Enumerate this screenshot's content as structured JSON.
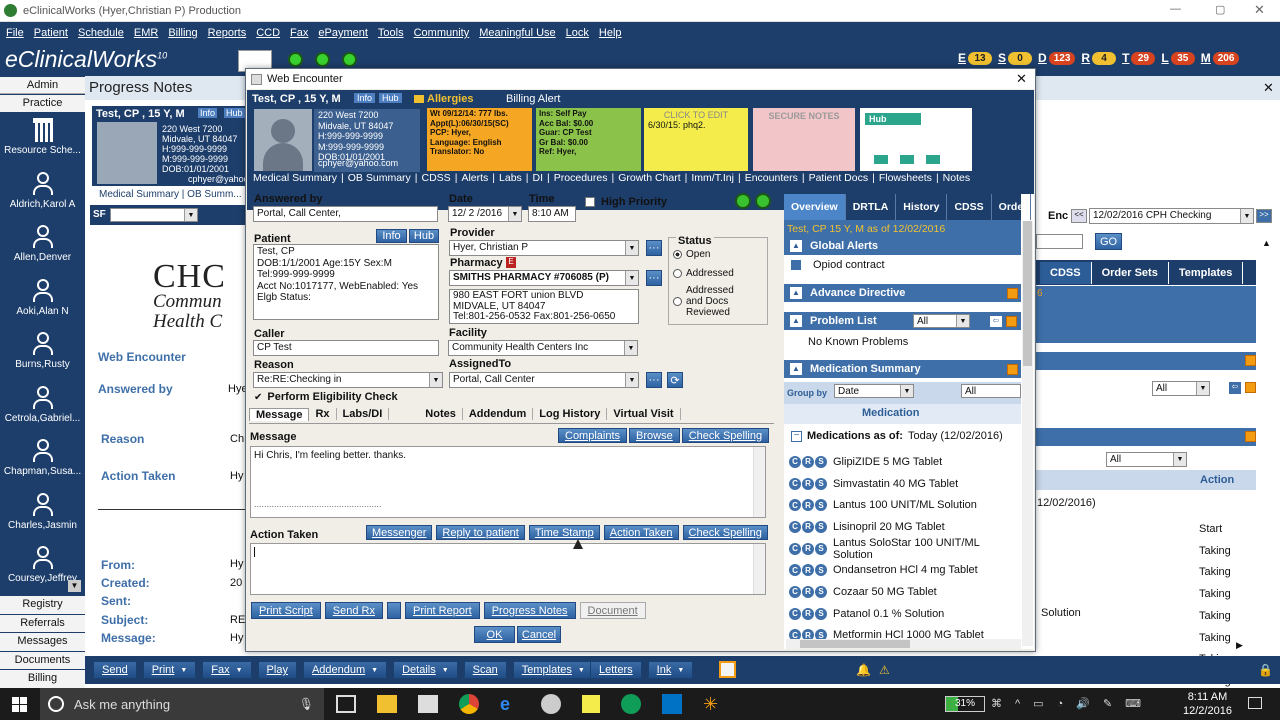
{
  "window": {
    "title": "eClinicalWorks (Hyer,Christian P)  Production"
  },
  "menu": [
    "File",
    "Patient",
    "Schedule",
    "EMR",
    "Billing",
    "Reports",
    "CCD",
    "Fax",
    "ePayment",
    "Tools",
    "Community",
    "Meaningful Use",
    "Lock",
    "Help"
  ],
  "brand": {
    "name": "eClinicalWorks",
    "version": "10"
  },
  "counters": [
    {
      "letter": "E",
      "value": "13",
      "color": "#f0c030"
    },
    {
      "letter": "S",
      "value": "0",
      "color": "#f0c030"
    },
    {
      "letter": "D",
      "value": "123",
      "color": "#d8431f"
    },
    {
      "letter": "R",
      "value": "4",
      "color": "#f0c030"
    },
    {
      "letter": "T",
      "value": "29",
      "color": "#d8431f"
    },
    {
      "letter": "L",
      "value": "35",
      "color": "#d8431f"
    },
    {
      "letter": "M",
      "value": "206",
      "color": "#d8431f"
    }
  ],
  "sidebar": {
    "top_items": [
      "Admin",
      "Practice"
    ],
    "users": [
      "Resource Sche...",
      "Aldrich,Karol A",
      "Allen,Denver",
      "Aoki,Alan N",
      "Burns,Rusty",
      "Cetrola,Gabriel...",
      "Chapman,Susa...",
      "Charles,Jasmin",
      "Coursey,Jeffrey"
    ],
    "bottom_items": [
      "Registry",
      "Referrals",
      "Messages",
      "Documents",
      "Billing"
    ]
  },
  "progress_notes": {
    "title": "Progress Notes",
    "patient": "Test, CP , 15 Y, M",
    "info": "Info",
    "hub": "Hub",
    "address": [
      "220 West 7200",
      "Midvale, UT 84047",
      "H:999-999-9999",
      "M:999-999-9999",
      "DOB:01/01/2001"
    ],
    "email": "cphyer@yahoo.c...",
    "tabs": "Medical Summary | OB Summ...",
    "sf": "SF",
    "logo_text": [
      "CHC",
      "Commun",
      "Health C"
    ],
    "web_encounter": "Web Encounter",
    "answered_by": "Answered by",
    "answered_val": "Hye",
    "reason": "Reason",
    "reason_val": "Ch",
    "action_taken": "Action Taken",
    "action_val": "Hy",
    "from": "From:",
    "from_val": "Hy",
    "created": "Created:",
    "created_val": "20",
    "sent": "Sent:",
    "subject": "Subject:",
    "subject_val": "RE",
    "message": "Message:",
    "message_val": "Hy"
  },
  "right_panel": {
    "enc": "Enc",
    "enc_val": "12/02/2016 CPH Checking",
    "go": "GO",
    "tabs": [
      "CDSS",
      "Order Sets",
      "Templates"
    ],
    "all1": "All",
    "all2": "All",
    "date_partial": "12/02/2016)",
    "action_hdr": "Action",
    "actions": [
      "Start",
      "Taking",
      "Taking",
      "Taking",
      "Taking",
      "Taking",
      "Taking",
      "Taking"
    ],
    "solution": "Solution",
    "six": "6"
  },
  "dialog": {
    "title": "Web Encounter",
    "patient": "Test, CP , 15 Y, M",
    "info": "Info",
    "hub": "Hub",
    "allergies": "Allergies",
    "billing_alert": "Billing Alert",
    "address": [
      "220 West 7200",
      "Midvale, UT 84047",
      "H:999-999-9999",
      "M:999-999-9999",
      "DOB:01/01/2001"
    ],
    "email": "cphyer@yahoo.com",
    "vitals": [
      "Wt 09/12/14: 777 lbs.",
      "Appt(L):06/30/15(SC)",
      "PCP:   Hyer,",
      "Language: English",
      "Translator: No"
    ],
    "insurance": [
      "Ins:   Self Pay",
      "Acc Bal: $0.00",
      "Guar:  CP Test",
      "Gr Bal: $0.00",
      "Ref:   Hyer,"
    ],
    "sticky": {
      "title": "CLICK TO EDIT",
      "text": "6/30/15: phq2."
    },
    "secure": "SECURE NOTES",
    "hub_box": "Hub",
    "nav": [
      "Medical Summary",
      "OB Summary",
      "CDSS",
      "Alerts",
      "Labs",
      "DI",
      "Procedures",
      "Growth Chart",
      "Imm/T.Inj",
      "Encounters",
      "Patient Docs",
      "Flowsheets",
      "Notes"
    ],
    "form": {
      "answered_by_label": "Answered by",
      "answered_by": "Portal, Call Center,",
      "date_label": "Date",
      "date": "12/ 2 /2016",
      "time_label": "Time",
      "time": "8:10 AM",
      "high_priority": "High Priority",
      "patient_label": "Patient",
      "info": "Info",
      "hub": "Hub",
      "patient_lines": [
        "Test, CP",
        "DOB:1/1/2001  Age:15Y  Sex:M",
        "Tel:999-999-9999",
        "Acct No:1017177, WebEnabled: Yes",
        "Elgb Status:"
      ],
      "provider_label": "Provider",
      "provider": "Hyer, Christian P",
      "pharmacy_label": "Pharmacy",
      "pharmacy": "SMITHS PHARMACY #706085 (P)",
      "pharmacy_addr": [
        "980 EAST FORT union BLVD",
        "MIDVALE, UT 84047",
        "Tel:801-256-0532 Fax:801-256-0650"
      ],
      "status_label": "Status",
      "status_opts": [
        "Open",
        "Addressed",
        "Addressed and Docs Reviewed"
      ],
      "caller_label": "Caller",
      "caller": "CP Test",
      "facility_label": "Facility",
      "facility": "Community Health Centers Inc",
      "reason_label": "Reason",
      "reason": "Re:RE:Checking in",
      "assigned_label": "AssignedTo",
      "assigned": "Portal, Call Center",
      "eligibility": "Perform Eligibility Check"
    },
    "msg_tabs": [
      "Message",
      "Rx",
      "Labs/DI",
      "Notes",
      "Addendum",
      "Log History",
      "Virtual Visit"
    ],
    "message_label": "Message",
    "message_btns": [
      "Complaints",
      "Browse",
      "Check Spelling"
    ],
    "message_text": "Hi Chris, I'm feeling better. thanks.",
    "message_dots": "...................................................",
    "action_label": "Action Taken",
    "action_btns": [
      "Messenger",
      "Reply to patient",
      "Time Stamp",
      "Action Taken",
      "Check Spelling"
    ],
    "bottom_btns": [
      "Print Script",
      "Send Rx",
      "Print Report",
      "Progress Notes",
      "Document"
    ],
    "ok": "OK",
    "cancel": "Cancel",
    "right": {
      "tabs": [
        "Overview",
        "DRTLA",
        "History",
        "CDSS",
        "Orde"
      ],
      "patient_line": "Test, CP 15 Y, M as of 12/02/2016",
      "global_alerts": "Global Alerts",
      "opioid": "Opiod contract",
      "advance": "Advance Directive",
      "problem": "Problem List",
      "problem_all": "All",
      "no_problems": "No Known Problems",
      "med_summary": "Medication Summary",
      "group_by": "Group by",
      "group_val": "Date",
      "group_all": "All",
      "medication_hdr": "Medication",
      "meds_asof": "Medications as of:",
      "meds_date": "Today (12/02/2016)",
      "meds": [
        "GlipiZIDE 5 MG Tablet",
        "Simvastatin 40 MG Tablet",
        "Lantus 100 UNIT/ML Solution",
        "Lisinopril 20 MG Tablet",
        "Lantus SoloStar 100 UNIT/ML Solution",
        "Ondansetron HCl 4 mg Tablet",
        "Cozaar 50 MG Tablet",
        "Patanol 0.1 % Solution",
        "Metformin HCl 1000 MG Tablet"
      ]
    }
  },
  "bottom_bar": {
    "left": [
      "Send",
      "Print",
      "Fax",
      "Play",
      "Addendum",
      "Details",
      "Scan",
      "Templates"
    ],
    "right": [
      "Letters",
      "Ink"
    ]
  },
  "taskbar": {
    "search": "Ask me anything",
    "battery": "31%",
    "time": "8:11 AM",
    "date": "12/2/2016"
  }
}
